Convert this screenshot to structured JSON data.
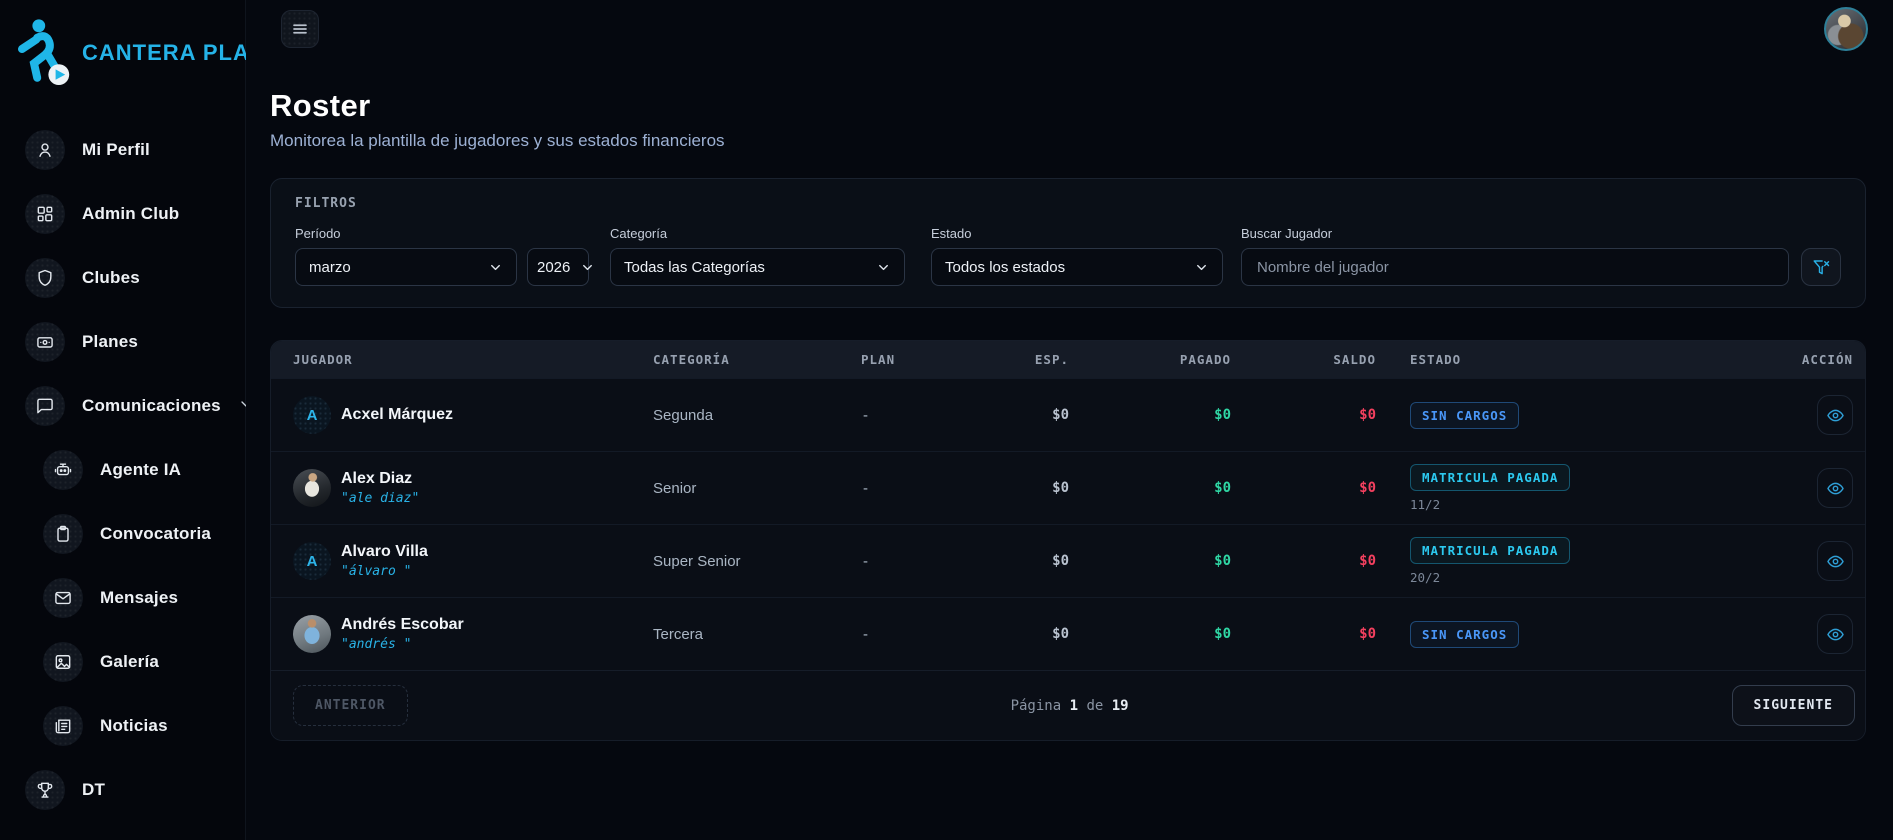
{
  "brand": {
    "name": "CANTERA PLAY",
    "accent_color": "#1fb6e8",
    "logo_icon": "soccer-player-play-icon"
  },
  "topbar": {
    "menu_icon": "hamburger-icon",
    "avatar_icon": "user-avatar"
  },
  "sidebar": {
    "items": [
      {
        "label": "Mi Perfil",
        "icon": "user-icon",
        "level": 0
      },
      {
        "label": "Admin Club",
        "icon": "grid-icon",
        "level": 0
      },
      {
        "label": "Clubes",
        "icon": "shield-icon",
        "level": 0
      },
      {
        "label": "Planes",
        "icon": "card-icon",
        "level": 0
      },
      {
        "label": "Comunicaciones",
        "icon": "chat-icon",
        "level": 0,
        "expandable": true,
        "chevron": "chevron-down-icon"
      },
      {
        "label": "Agente IA",
        "icon": "robot-icon",
        "level": 1
      },
      {
        "label": "Convocatoria",
        "icon": "clipboard-icon",
        "level": 1
      },
      {
        "label": "Mensajes",
        "icon": "mail-icon",
        "level": 1
      },
      {
        "label": "Galería",
        "icon": "image-icon",
        "level": 1
      },
      {
        "label": "Noticias",
        "icon": "news-icon",
        "level": 1
      },
      {
        "label": "DT",
        "icon": "trophy-icon",
        "level": 0
      }
    ]
  },
  "header": {
    "title": "Roster",
    "subtitle": "Monitorea la plantilla de jugadores y sus estados financieros"
  },
  "filters": {
    "title": "FILTROS",
    "period_label": "Período",
    "period_value": "marzo",
    "year_value": "2026",
    "category_label": "Categoría",
    "category_value": "Todas las Categorías",
    "status_label": "Estado",
    "status_value": "Todos los estados",
    "search_label": "Buscar Jugador",
    "search_placeholder": "Nombre del jugador",
    "clear_icon": "filter-x-icon"
  },
  "table": {
    "columns": [
      "JUGADOR",
      "CATEGORÍA",
      "PLAN",
      "ESP.",
      "PAGADO",
      "SALDO",
      "ESTADO",
      "ACCIÓN"
    ],
    "rows": [
      {
        "name": "Acxel Márquez",
        "nickname": "",
        "initial": "A",
        "avatar_type": "letter",
        "category": "Segunda",
        "plan": "-",
        "esp": "$0",
        "pagado": "$0",
        "saldo": "$0",
        "status": "SIN CARGOS",
        "status_color": "blue",
        "status_sub": ""
      },
      {
        "name": "Alex Diaz",
        "nickname": "\"ale diaz\"",
        "initial": "",
        "avatar_type": "photo",
        "category": "Senior",
        "plan": "-",
        "esp": "$0",
        "pagado": "$0",
        "saldo": "$0",
        "status": "MATRICULA PAGADA",
        "status_color": "cyan",
        "status_sub": "11/2"
      },
      {
        "name": "Alvaro Villa",
        "nickname": "\"álvaro \"",
        "initial": "A",
        "avatar_type": "letter",
        "category": "Super Senior",
        "plan": "-",
        "esp": "$0",
        "pagado": "$0",
        "saldo": "$0",
        "status": "MATRICULA PAGADA",
        "status_color": "cyan",
        "status_sub": "20/2"
      },
      {
        "name": "Andrés Escobar",
        "nickname": "\"andrés \"",
        "initial": "",
        "avatar_type": "photo",
        "category": "Tercera",
        "plan": "-",
        "esp": "$0",
        "pagado": "$0",
        "saldo": "$0",
        "status": "SIN CARGOS",
        "status_color": "blue",
        "status_sub": ""
      }
    ],
    "action_icon": "eye-icon"
  },
  "pagination": {
    "prev_label": "ANTERIOR",
    "page_label": "Página",
    "current_page": "1",
    "separator": "de",
    "total_pages": "19",
    "next_label": "SIGUIENTE"
  },
  "colors": {
    "accent_cyan": "#1fb6e8",
    "paid_green": "#2fd6a4",
    "balance_red": "#f4405f",
    "badge_cyan": "#2cc9ef",
    "badge_blue": "#4a97f8"
  }
}
